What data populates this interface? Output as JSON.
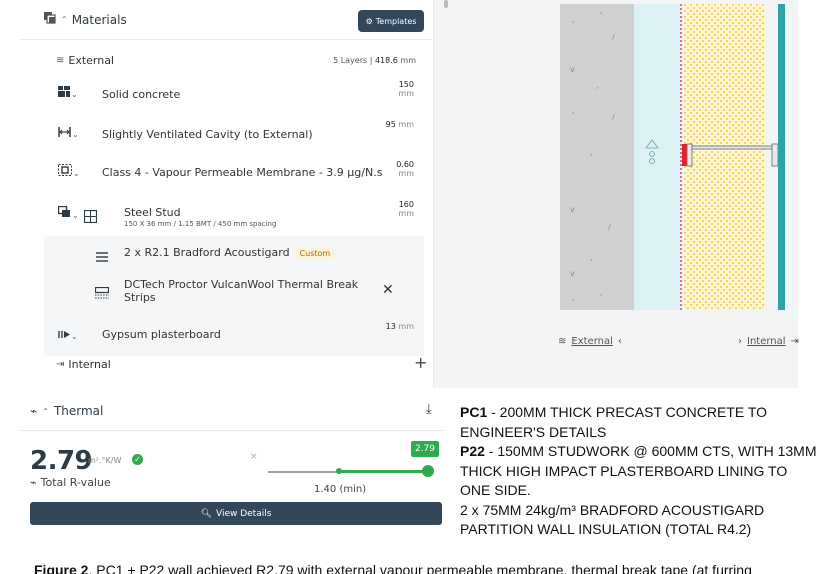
{
  "materials": {
    "title": "Materials",
    "templates_label": "Templates",
    "external_label": "External",
    "external_meta_layers": "5 Layers |",
    "external_meta_total": "418.6",
    "external_meta_unit": "mm",
    "internal_label": "Internal",
    "layers": [
      {
        "name": "Solid concrete",
        "thickness": "150",
        "unit": "mm"
      },
      {
        "name": "Slightly Ventilated Cavity (to External)",
        "thickness": "95",
        "unit": "mm"
      },
      {
        "name": "Class 4 - Vapour Permeable Membrane - 3.9 μg/N.s",
        "thickness": "0.60",
        "unit": "mm"
      },
      {
        "name": "Gypsum plasterboard",
        "thickness": "13",
        "unit": "mm"
      }
    ],
    "stud": {
      "name": "Steel Stud",
      "spec": "150 X 36 mm / 1.15 BMT / 450 mm spacing",
      "thickness": "160",
      "unit": "mm",
      "insulation": "2 x R2.1 Bradford Acoustigard",
      "custom_badge": "Custom",
      "thermal_break": "DCTech Proctor VulcanWool Thermal Break Strips"
    }
  },
  "diagram": {
    "external_label": "External",
    "internal_label": "Internal"
  },
  "thermal": {
    "title": "Thermal",
    "r_value": "2.79",
    "r_unit": "m².°K/W",
    "r_label": "Total R-value",
    "slider_value": "2.79",
    "slider_min_label": "1.40 (min)",
    "slider_x": "×",
    "view_details_label": "View Details"
  },
  "spec": {
    "pc1_code": "PC1",
    "pc1_text": " - 200MM THICK PRECAST CONCRETE TO ENGINEER'S DETAILS",
    "p22_code": "P22",
    "p22_text": " - 150MM STUDWORK @ 600MM CTS, WITH 13MM THICK HIGH IMPACT PLASTERBOARD LINING TO ONE SIDE.",
    "p22_insulation": "2 x 75MM 24kg/m³ BRADFORD ACOUSTIGARD PARTITION WALL INSULATION (TOTAL R4.2)"
  },
  "caption": {
    "label": "Figure 2",
    "text": ". PC1 + P22 wall achieved R2.79 with external vapour permeable membrane, thermal break tape (at furring"
  },
  "colors": {
    "accent_dark": "#33475b",
    "success": "#2eaa4f",
    "concrete": "#cfd0d1",
    "cavity": "#dcf1f3",
    "insulation": "#fdf6d3",
    "stud_accent": "#e8202a",
    "board": "#2ba3a8"
  }
}
